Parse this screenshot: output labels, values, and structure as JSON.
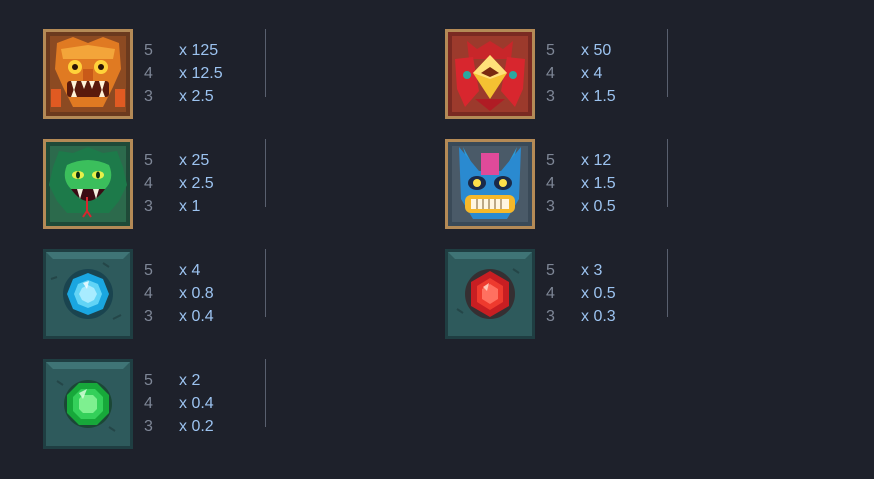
{
  "paytable": {
    "symbols": [
      {
        "id": "jaguar-mask",
        "payouts": [
          {
            "count": "5",
            "mult": "x 125"
          },
          {
            "count": "4",
            "mult": "x 12.5"
          },
          {
            "count": "3",
            "mult": "x 2.5"
          }
        ]
      },
      {
        "id": "bird-mask",
        "payouts": [
          {
            "count": "5",
            "mult": "x 50"
          },
          {
            "count": "4",
            "mult": "x 4"
          },
          {
            "count": "3",
            "mult": "x 1.5"
          }
        ]
      },
      {
        "id": "serpent-mask",
        "payouts": [
          {
            "count": "5",
            "mult": "x 25"
          },
          {
            "count": "4",
            "mult": "x 2.5"
          },
          {
            "count": "3",
            "mult": "x 1"
          }
        ]
      },
      {
        "id": "blue-demon-mask",
        "payouts": [
          {
            "count": "5",
            "mult": "x 12"
          },
          {
            "count": "4",
            "mult": "x 1.5"
          },
          {
            "count": "3",
            "mult": "x 0.5"
          }
        ]
      },
      {
        "id": "blue-gem",
        "payouts": [
          {
            "count": "5",
            "mult": "x 4"
          },
          {
            "count": "4",
            "mult": "x 0.8"
          },
          {
            "count": "3",
            "mult": "x 0.4"
          }
        ]
      },
      {
        "id": "red-gem",
        "payouts": [
          {
            "count": "5",
            "mult": "x 3"
          },
          {
            "count": "4",
            "mult": "x 0.5"
          },
          {
            "count": "3",
            "mult": "x 0.3"
          }
        ]
      },
      {
        "id": "green-gem",
        "payouts": [
          {
            "count": "5",
            "mult": "x 2"
          },
          {
            "count": "4",
            "mult": "x 0.4"
          },
          {
            "count": "3",
            "mult": "x 0.2"
          }
        ]
      }
    ]
  },
  "colors": {
    "background": "#1e212b",
    "count_text": "#7e8696",
    "multiplier_text": "#9cc3f0",
    "divider": "#59606f",
    "gold_frame": "#b88a56",
    "stone_tile": "#2f5a5c"
  }
}
